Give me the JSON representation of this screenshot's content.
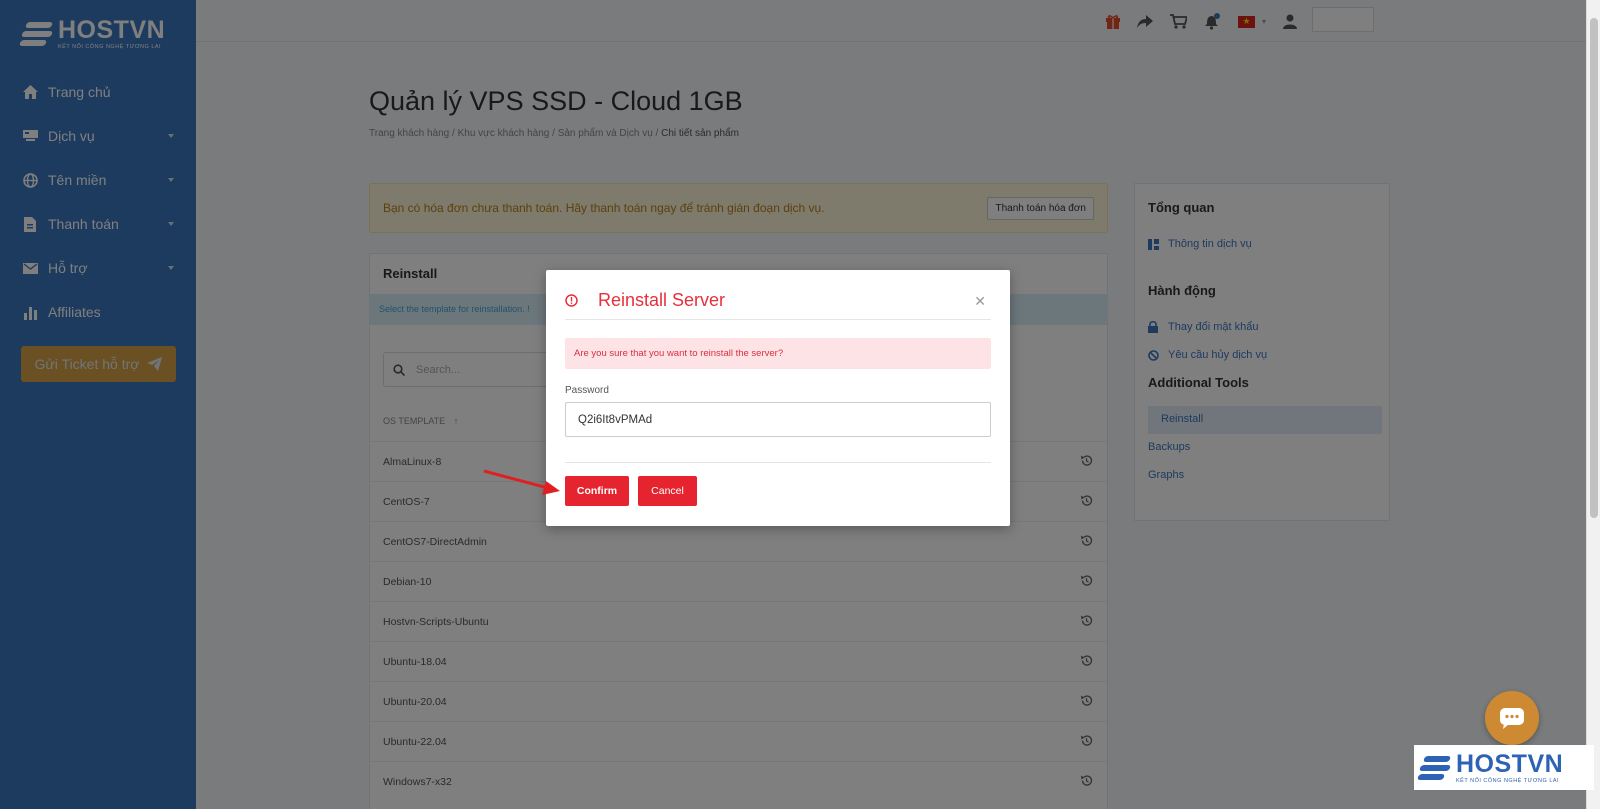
{
  "brand": {
    "name": "HOSTVN",
    "tagline": "KẾT NỐI CÔNG NGHỆ TƯƠNG LAI",
    "color": "#3a77bd"
  },
  "sidebar": {
    "items": [
      {
        "label": "Trang chủ",
        "icon": "home-icon"
      },
      {
        "label": "Dịch vụ",
        "icon": "server-icon"
      },
      {
        "label": "Tên miền",
        "icon": "globe-icon"
      },
      {
        "label": "Thanh toán",
        "icon": "invoice-icon"
      },
      {
        "label": "Hỗ trợ",
        "icon": "envelope-icon"
      },
      {
        "label": "Affiliates",
        "icon": "bar-chart-icon"
      }
    ],
    "ticket_button": "Gửi Ticket hỗ trợ"
  },
  "page": {
    "title": "Quản lý VPS SSD - Cloud 1GB",
    "breadcrumb": [
      "Trang khách hàng",
      "Khu vực khách hàng",
      "Sản phẩm và Dịch vụ",
      "Chi tiết sản phẩm"
    ]
  },
  "alert": {
    "text": "Bạn có hóa đơn chưa thanh toán. Hãy thanh toán ngay để tránh gián đoạn dịch vụ.",
    "button": "Thanh toán hóa đơn"
  },
  "reinstall": {
    "title": "Reinstall",
    "info": "Select the template for reinstallation. !",
    "search_placeholder": "Search...",
    "column_header": "OS TEMPLATE",
    "templates": [
      "AlmaLinux-8",
      "CentOS-7",
      "CentOS7-DirectAdmin",
      "Debian-10",
      "Hostvn-Scripts-Ubuntu",
      "Ubuntu-18.04",
      "Ubuntu-20.04",
      "Ubuntu-22.04",
      "Windows7-x32"
    ]
  },
  "side": {
    "overview_title": "Tổng quan",
    "service_info": "Thông tin dịch vụ",
    "actions_title": "Hành động",
    "change_password": "Thay đổi mật khẩu",
    "cancel_request": "Yêu cầu hủy dịch vụ",
    "tools_title": "Additional Tools",
    "tools": [
      "Reinstall",
      "Backups",
      "Graphs"
    ]
  },
  "modal": {
    "title": "Reinstall Server",
    "warning": "Are you sure that you want to reinstall the server?",
    "password_label": "Password",
    "password_value": "Q2i6It8vPMAd",
    "confirm": "Confirm",
    "cancel": "Cancel",
    "accent": "#e6242f"
  }
}
